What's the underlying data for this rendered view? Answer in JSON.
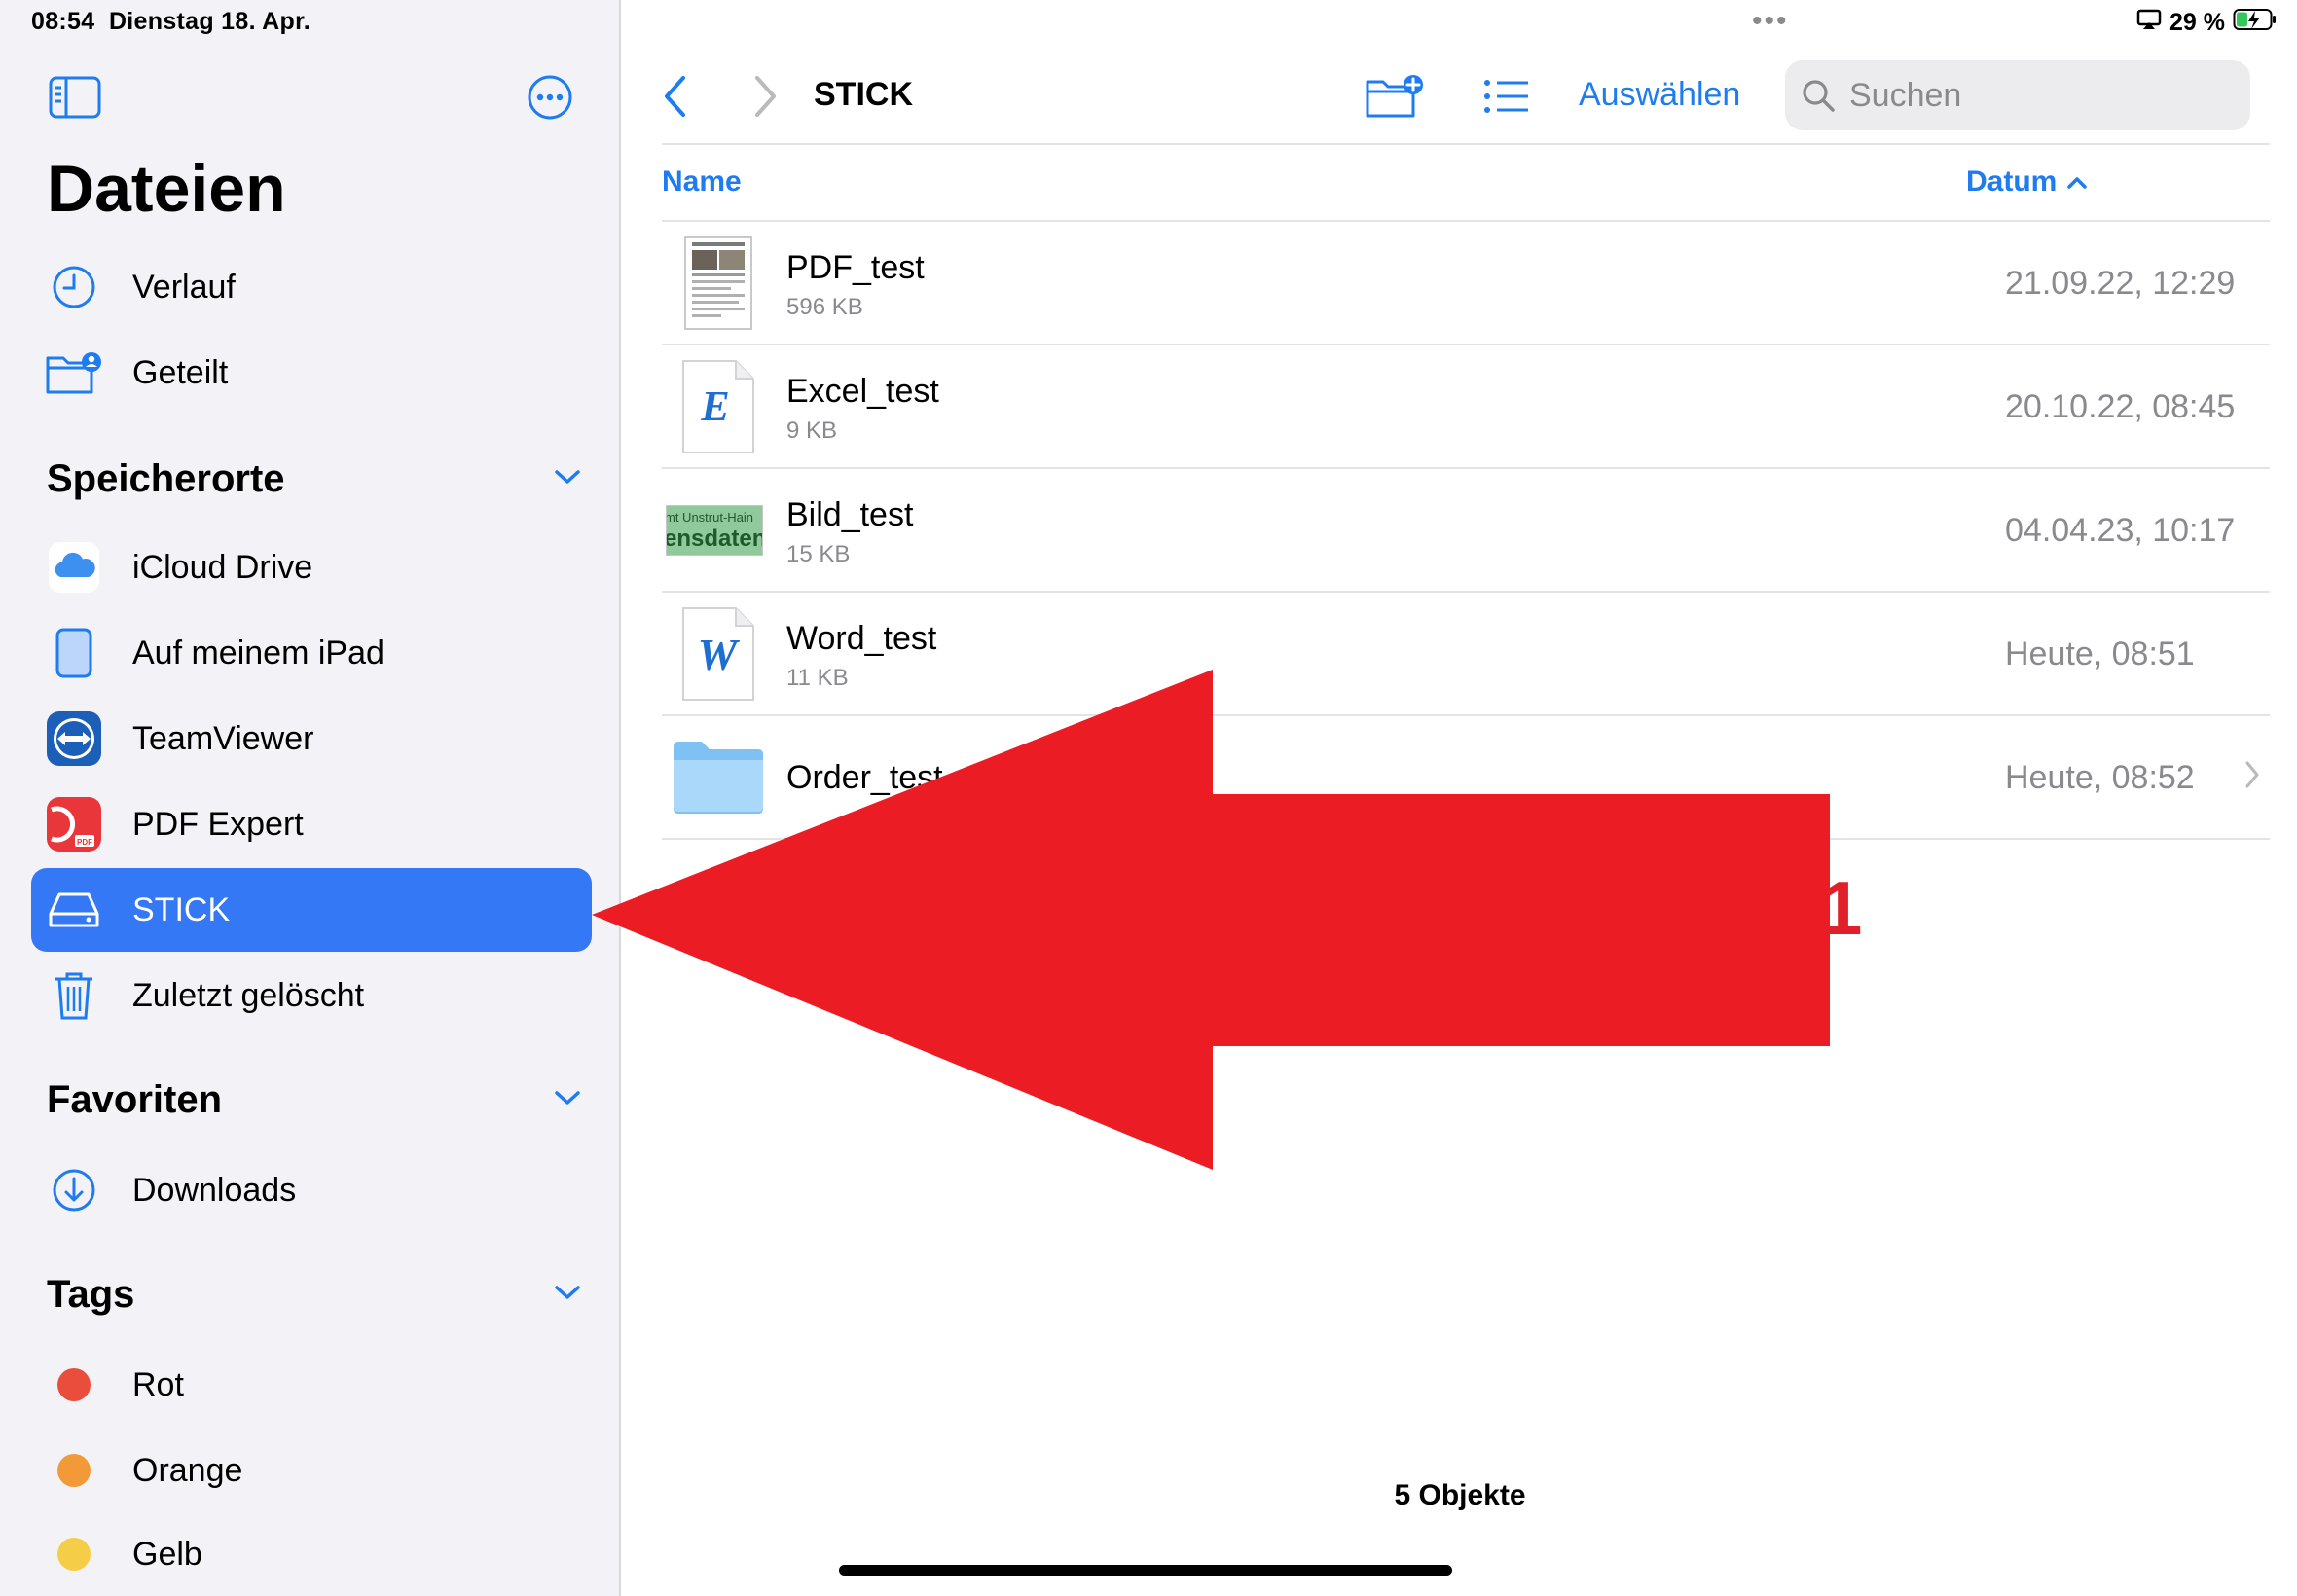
{
  "status": {
    "time": "08:54",
    "date": "Dienstag 18. Apr.",
    "battery": "29 %"
  },
  "sidebar": {
    "title": "Dateien",
    "recent": [
      {
        "label": "Verlauf",
        "icon": "clock-icon"
      },
      {
        "label": "Geteilt",
        "icon": "shared-folder-icon"
      }
    ],
    "locations_header": "Speicherorte",
    "locations": [
      {
        "label": "iCloud Drive",
        "icon": "icloud-icon"
      },
      {
        "label": "Auf meinem iPad",
        "icon": "ipad-icon"
      },
      {
        "label": "TeamViewer",
        "icon": "teamviewer-icon"
      },
      {
        "label": "PDF Expert",
        "icon": "pdf-expert-icon"
      },
      {
        "label": "STICK",
        "icon": "drive-icon",
        "selected": true
      },
      {
        "label": "Zuletzt gelöscht",
        "icon": "trash-icon"
      }
    ],
    "favorites_header": "Favoriten",
    "favorites": [
      {
        "label": "Downloads",
        "icon": "download-icon"
      }
    ],
    "tags_header": "Tags",
    "tags": [
      {
        "label": "Rot",
        "color": "#eb4d3d"
      },
      {
        "label": "Orange",
        "color": "#f19a37"
      },
      {
        "label": "Gelb",
        "color": "#f6cd46"
      }
    ]
  },
  "toolbar": {
    "title": "STICK",
    "select_label": "Auswählen",
    "search_placeholder": "Suchen"
  },
  "columns": {
    "name": "Name",
    "date": "Datum"
  },
  "files": [
    {
      "name": "PDF_test",
      "size": "596 KB",
      "date": "21.09.22, 12:29",
      "icon": "pdf-thumbnail"
    },
    {
      "name": "Excel_test",
      "size": "9 KB",
      "date": "20.10.22, 08:45",
      "icon": "excel-icon"
    },
    {
      "name": "Bild_test",
      "size": "15 KB",
      "date": "04.04.23, 10:17",
      "icon": "image-thumbnail",
      "thumb_text_1": "mt Unstrut-Hain",
      "thumb_text_2": "ensdaten"
    },
    {
      "name": "Word_test",
      "size": "11 KB",
      "date": "Heute, 08:51",
      "icon": "word-icon"
    },
    {
      "name": "Order_test",
      "size": "",
      "date": "Heute, 08:52",
      "icon": "folder-icon"
    }
  ],
  "footer": {
    "count": "5 Objekte"
  },
  "annotation": {
    "label": "1",
    "color": "#ec1c24"
  },
  "colors": {
    "accent": "#1f7cf0",
    "selected_bg": "#3478f6",
    "sidebar_bg": "#f2f2f7"
  }
}
